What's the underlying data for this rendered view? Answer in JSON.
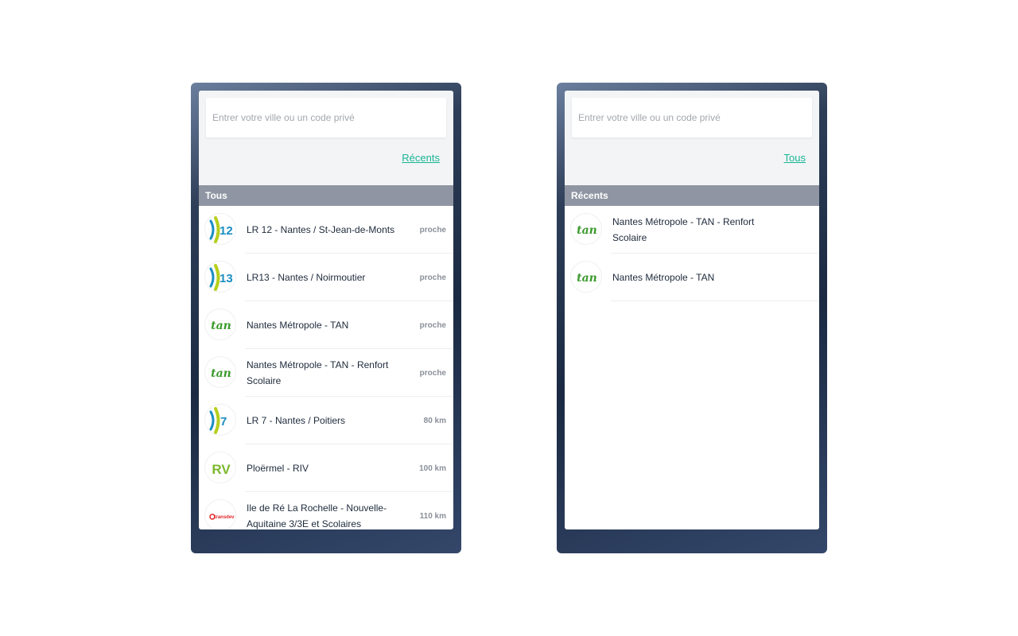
{
  "left_panel": {
    "search": {
      "placeholder": "Entrer votre ville ou un code privé"
    },
    "toggle_link": "Récents",
    "section_title": "Tous",
    "networks": [
      {
        "name": "LR 12 - Nantes / St-Jean-de-Monts",
        "distance": "proche",
        "logo": "lr12-logo"
      },
      {
        "name": "LR13 - Nantes / Noirmoutier",
        "distance": "proche",
        "logo": "lr13-logo"
      },
      {
        "name": "Nantes Métropole - TAN",
        "distance": "proche",
        "logo": "tan-logo"
      },
      {
        "name": "Nantes Métropole - TAN - Renfort Scolaire",
        "distance": "proche",
        "logo": "tan-logo"
      },
      {
        "name": "LR 7 - Nantes / Poitiers",
        "distance": "80 km",
        "logo": "lr7-logo"
      },
      {
        "name": "Ploërmel - RIV",
        "distance": "100 km",
        "logo": "riv-logo"
      },
      {
        "name": "Ile de Ré La Rochelle - Nouvelle-Aquitaine 3/3E et Scolaires",
        "distance": "110 km",
        "logo": "transdev-logo"
      }
    ]
  },
  "right_panel": {
    "search": {
      "placeholder": "Entrer votre ville ou un code privé"
    },
    "toggle_link": "Tous",
    "section_title": "Récents",
    "networks": [
      {
        "name": "Nantes Métropole - TAN - Renfort Scolaire",
        "logo": "tan-logo"
      },
      {
        "name": "Nantes Métropole - TAN",
        "logo": "tan-logo"
      }
    ]
  },
  "logo_texts": {
    "lr12": "12",
    "lr13": "13",
    "lr7": "7",
    "tan": "tan",
    "riv": "RV",
    "transdev": "transdev"
  },
  "colors": {
    "accent_link": "#19b595",
    "section_header": "#8f95a2",
    "frame_dark": "#1b2a42",
    "lr_blue": "#1a8ec2",
    "lr_green": "#b7cf1b",
    "tan_green": "#3c9a2e",
    "transdev_red": "#e0262b"
  }
}
